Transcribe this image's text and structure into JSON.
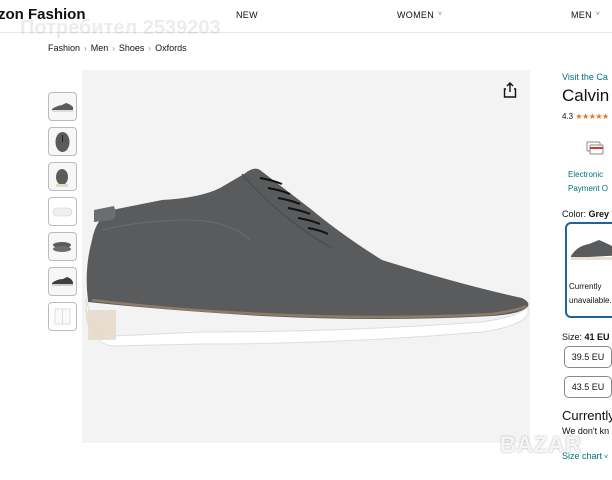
{
  "header": {
    "brand": "zon Fashion",
    "nav": [
      {
        "label": "NEW"
      },
      {
        "label": "WOMEN"
      },
      {
        "label": "MEN"
      }
    ]
  },
  "watermark_top": "Потребител 2539203",
  "breadcrumb": [
    "Fashion",
    "Men",
    "Shoes",
    "Oxfords"
  ],
  "thumbnails": [
    "shoe-side-thumb",
    "shoe-top-thumb",
    "shoe-front-thumb",
    "shoe-sole-thumb",
    "shoe-pair-thumb",
    "shoe-side-dark-thumb",
    "shoe-box-thumb"
  ],
  "product": {
    "visit_link": "Visit the Ca",
    "title": "Calvin",
    "rating": "4.3",
    "stars": "★★★★★",
    "payment_line1": "Electronic",
    "payment_line2": "Payment O",
    "color_label": "Color:",
    "color_value": "Grey",
    "swatch_status_1": "Currently",
    "swatch_status_2": "unavailable.",
    "size_label": "Size:",
    "size_value": "41 EU",
    "sizes": [
      "39.5 EU",
      "43.5 EU"
    ],
    "currently": "Currently",
    "we_dont": "We don't kn",
    "size_chart": "Size chart"
  },
  "watermark_bottom": "BAZAR",
  "colors": {
    "link": "#007185",
    "star": "#de7921",
    "selected_border": "#2162a1",
    "shoe": "#5a5b5d"
  }
}
